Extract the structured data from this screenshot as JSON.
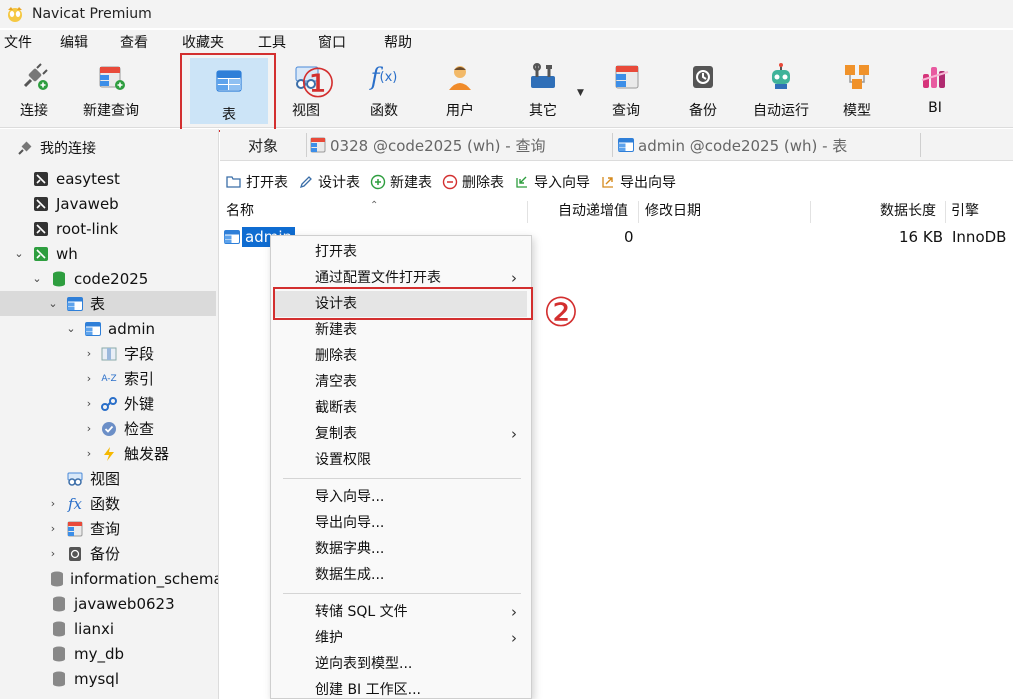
{
  "app": {
    "title": "Navicat Premium"
  },
  "menu": [
    "文件",
    "编辑",
    "查看",
    "收藏夹",
    "工具",
    "窗口",
    "帮助"
  ],
  "toolbar": [
    {
      "label": "连接",
      "icon": "connect-icon"
    },
    {
      "label": "新建查询",
      "icon": "new-query-icon"
    },
    {
      "label": "表",
      "icon": "table-icon",
      "active": true
    },
    {
      "label": "视图",
      "icon": "view-icon"
    },
    {
      "label": "函数",
      "icon": "function-icon"
    },
    {
      "label": "用户",
      "icon": "user-icon"
    },
    {
      "label": "其它",
      "icon": "tools-icon"
    },
    {
      "label": "查询",
      "icon": "query-icon"
    },
    {
      "label": "备份",
      "icon": "backup-icon"
    },
    {
      "label": "自动运行",
      "icon": "robot-icon"
    },
    {
      "label": "模型",
      "icon": "model-icon"
    },
    {
      "label": "BI",
      "icon": "bi-icon"
    }
  ],
  "annotations": {
    "step1": "①",
    "step2": "②"
  },
  "sidebar": {
    "header": "我的连接",
    "items": [
      {
        "label": "easytest"
      },
      {
        "label": "Javaweb"
      },
      {
        "label": "root-link"
      },
      {
        "label": "wh"
      },
      {
        "label": "code2025"
      },
      {
        "label": "表"
      },
      {
        "label": "admin"
      },
      {
        "label": "字段"
      },
      {
        "label": "索引"
      },
      {
        "label": "外键"
      },
      {
        "label": "检查"
      },
      {
        "label": "触发器"
      },
      {
        "label": "视图"
      },
      {
        "label": "函数"
      },
      {
        "label": "查询"
      },
      {
        "label": "备份"
      },
      {
        "label": "information_schema"
      },
      {
        "label": "javaweb0623"
      },
      {
        "label": "lianxi"
      },
      {
        "label": "my_db"
      },
      {
        "label": "mysql"
      }
    ]
  },
  "tabs": [
    {
      "label": "对象"
    },
    {
      "label": "0328 @code2025 (wh) - 查询"
    },
    {
      "label": "admin @code2025 (wh) - 表"
    }
  ],
  "objectToolbar": [
    {
      "label": "打开表"
    },
    {
      "label": "设计表"
    },
    {
      "label": "新建表"
    },
    {
      "label": "删除表"
    },
    {
      "label": "导入向导"
    },
    {
      "label": "导出向导"
    }
  ],
  "grid": {
    "columns": [
      "名称",
      "自动递增值",
      "修改日期",
      "数据长度",
      "引擎"
    ],
    "row": {
      "name": "admin",
      "auto_increment": "0",
      "modified": "",
      "data_length": "16 KB",
      "engine": "InnoDB"
    }
  },
  "contextMenu": [
    {
      "label": "打开表"
    },
    {
      "label": "通过配置文件打开表",
      "submenu": true
    },
    {
      "label": "设计表",
      "highlight": true
    },
    {
      "label": "新建表"
    },
    {
      "label": "删除表"
    },
    {
      "label": "清空表"
    },
    {
      "label": "截断表"
    },
    {
      "label": "复制表",
      "submenu": true
    },
    {
      "label": "设置权限"
    },
    {
      "label": "导入向导..."
    },
    {
      "label": "导出向导..."
    },
    {
      "label": "数据字典..."
    },
    {
      "label": "数据生成..."
    },
    {
      "label": "转储 SQL 文件",
      "submenu": true
    },
    {
      "label": "维护",
      "submenu": true
    },
    {
      "label": "逆向表到模型..."
    },
    {
      "label": "创建 BI 工作区..."
    }
  ],
  "colors": {
    "accent": "#0f6cd1",
    "annotation": "#d32f2f",
    "selectedToolbar": "#cce4f7"
  }
}
